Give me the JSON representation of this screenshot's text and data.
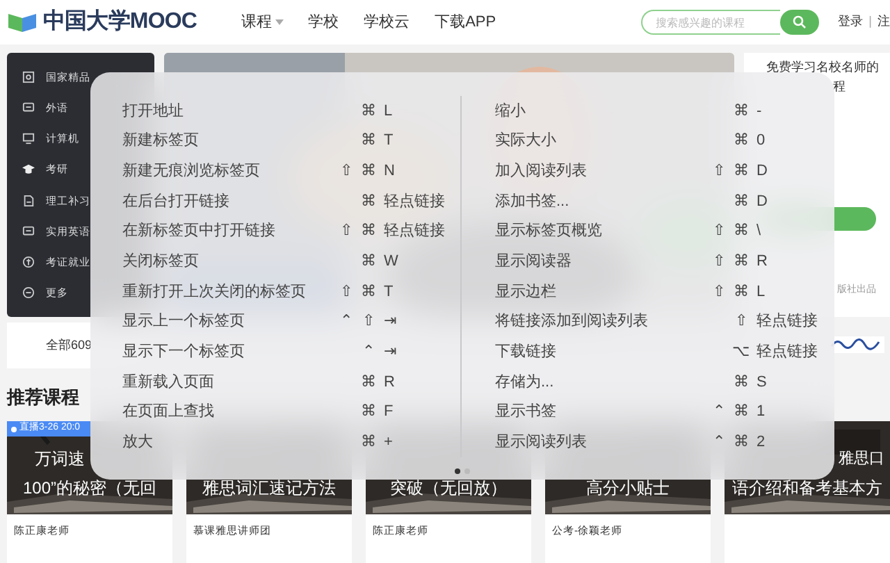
{
  "header": {
    "logo": "中国大学MOOC",
    "nav": [
      {
        "label": "课程",
        "dropdown": true
      },
      {
        "label": "学校",
        "dropdown": false
      },
      {
        "label": "学校云",
        "dropdown": false
      },
      {
        "label": "下载APP",
        "dropdown": false
      }
    ],
    "search": {
      "placeholder": "搜索感兴趣的课程"
    },
    "login": "登录",
    "separator": "|",
    "register": "注"
  },
  "sidebar": {
    "items": [
      {
        "label": "国家精品"
      },
      {
        "label": "外语"
      },
      {
        "label": "计算机"
      },
      {
        "label": "考研"
      },
      {
        "label": "理工补习"
      },
      {
        "label": "实用英语"
      },
      {
        "label": "考证就业"
      },
      {
        "label": "更多"
      }
    ]
  },
  "side_card": {
    "line_1": "免费学习名校名师的",
    "line_2": "程",
    "footer": "版社出品"
  },
  "all_courses": "全部609",
  "section_title": "推荐课程",
  "courses": [
    {
      "badge": "直播3-26 20:0",
      "title": [
        "万词速",
        "100”的秘密（无回"
      ],
      "teacher": "陈正康老师"
    },
    {
      "title": [
        "雅思词汇速记方法"
      ],
      "teacher": "慕课雅思讲师团"
    },
    {
      "title": [
        "突破（无回放）"
      ],
      "teacher": "陈正康老师"
    },
    {
      "title": [
        "高分小贴士"
      ],
      "teacher": "公考-徐颖老师"
    },
    {
      "title": [
        "雅思口",
        "语介绍和备考基本方"
      ]
    }
  ],
  "shortcuts": {
    "columns": [
      [
        {
          "label": "打开地址",
          "keys": [
            "⌘",
            "L"
          ]
        },
        {
          "label": "新建标签页",
          "keys": [
            "⌘",
            "T"
          ]
        },
        {
          "label": "新建无痕浏览标签页",
          "keys": [
            "⇧",
            "⌘",
            "N"
          ]
        },
        {
          "label": "在后台打开链接",
          "keys": [
            "⌘",
            "轻点链接"
          ]
        },
        {
          "label": "在新标签页中打开链接",
          "keys": [
            "⇧",
            "⌘",
            "轻点链接"
          ]
        },
        {
          "label": "关闭标签页",
          "keys": [
            "⌘",
            "W"
          ]
        },
        {
          "label": "重新打开上次关闭的标签页",
          "keys": [
            "⇧",
            "⌘",
            "T"
          ]
        },
        {
          "label": "显示上一个标签页",
          "keys": [
            "⌃",
            "⇧",
            "⇥"
          ]
        },
        {
          "label": "显示下一个标签页",
          "keys": [
            "⌃",
            "⇥"
          ]
        },
        {
          "label": "重新载入页面",
          "keys": [
            "⌘",
            "R"
          ]
        },
        {
          "label": "在页面上查找",
          "keys": [
            "⌘",
            "F"
          ]
        },
        {
          "label": "放大",
          "keys": [
            "⌘",
            "+"
          ]
        }
      ],
      [
        {
          "label": "缩小",
          "keys": [
            "⌘",
            "-"
          ]
        },
        {
          "label": "实际大小",
          "keys": [
            "⌘",
            "0"
          ]
        },
        {
          "label": "加入阅读列表",
          "keys": [
            "⇧",
            "⌘",
            "D"
          ]
        },
        {
          "label": "添加书签...",
          "keys": [
            "⌘",
            "D"
          ]
        },
        {
          "label": "显示标签页概览",
          "keys": [
            "⇧",
            "⌘",
            "\\"
          ]
        },
        {
          "label": "显示阅读器",
          "keys": [
            "⇧",
            "⌘",
            "R"
          ]
        },
        {
          "label": "显示边栏",
          "keys": [
            "⇧",
            "⌘",
            "L"
          ]
        },
        {
          "label": "将链接添加到阅读列表",
          "keys": [
            "⇧",
            "轻点链接"
          ]
        },
        {
          "label": "下载链接",
          "keys": [
            "⌥",
            "轻点链接"
          ]
        },
        {
          "label": "存储为...",
          "keys": [
            "⌘",
            "S"
          ]
        },
        {
          "label": "显示书签",
          "keys": [
            "⌃",
            "⌘",
            "1"
          ]
        },
        {
          "label": "显示阅读列表",
          "keys": [
            "⌃",
            "⌘",
            "2"
          ]
        }
      ]
    ],
    "pages": [
      {
        "selected": true
      },
      {
        "selected": false
      }
    ]
  }
}
